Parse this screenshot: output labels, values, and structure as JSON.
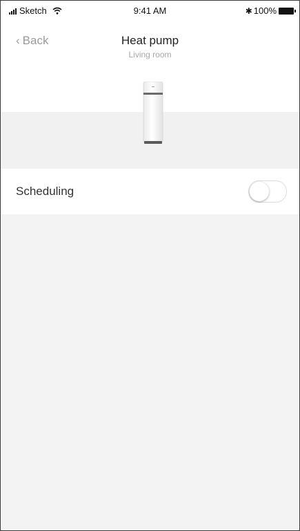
{
  "status_bar": {
    "carrier": "Sketch",
    "time": "9:41 AM",
    "battery": "100%",
    "icons": [
      "signal-icon",
      "wifi-icon",
      "bluetooth-icon",
      "battery-icon"
    ]
  },
  "nav": {
    "back_label": "Back",
    "title": "Heat pump",
    "subtitle": "Living room"
  },
  "device": {
    "image_name": "heat-pump-unit"
  },
  "settings": {
    "scheduling_label": "Scheduling",
    "scheduling_enabled": false
  },
  "colors": {
    "background": "#f3f3f3",
    "surface": "#ffffff",
    "muted_text": "#9a9a9a"
  }
}
